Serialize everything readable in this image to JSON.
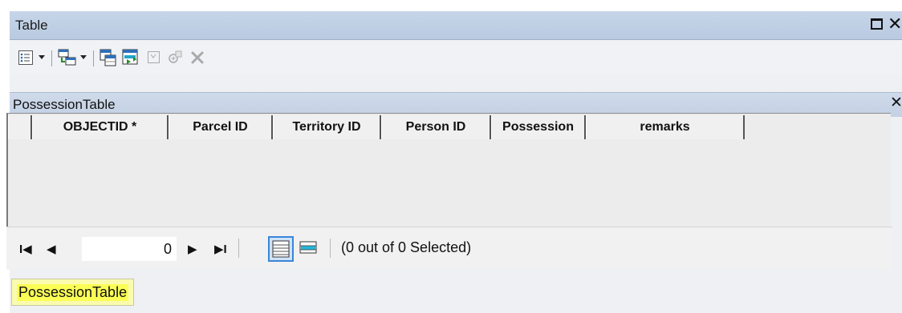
{
  "window": {
    "title": "Table",
    "maximize_icon": "maximize-icon",
    "close_label": "✕"
  },
  "toolbar": {
    "icons": [
      "table-options-icon",
      "dropdown-arrow-icon",
      "related-tables-icon",
      "dropdown-arrow-icon",
      "select-by-attributes-icon",
      "switch-selection-icon",
      "clear-selection-icon",
      "zoom-to-selected-icon",
      "delete-selected-icon"
    ]
  },
  "table_tab": {
    "name": "PossessionTable",
    "close_label": "✕"
  },
  "grid": {
    "columns": [
      {
        "label": "OBJECTID *"
      },
      {
        "label": "Parcel ID"
      },
      {
        "label": "Territory ID"
      },
      {
        "label": "Person ID"
      },
      {
        "label": "Possession"
      },
      {
        "label": "remarks"
      }
    ],
    "rows": []
  },
  "navigation": {
    "first_label": "I◀",
    "prev_label": "◀",
    "record_value": "0",
    "next_label": "▶",
    "last_label": "▶I",
    "status": "(0 out of 0 Selected)"
  },
  "bottom_tab": {
    "label": "PossessionTable"
  }
}
